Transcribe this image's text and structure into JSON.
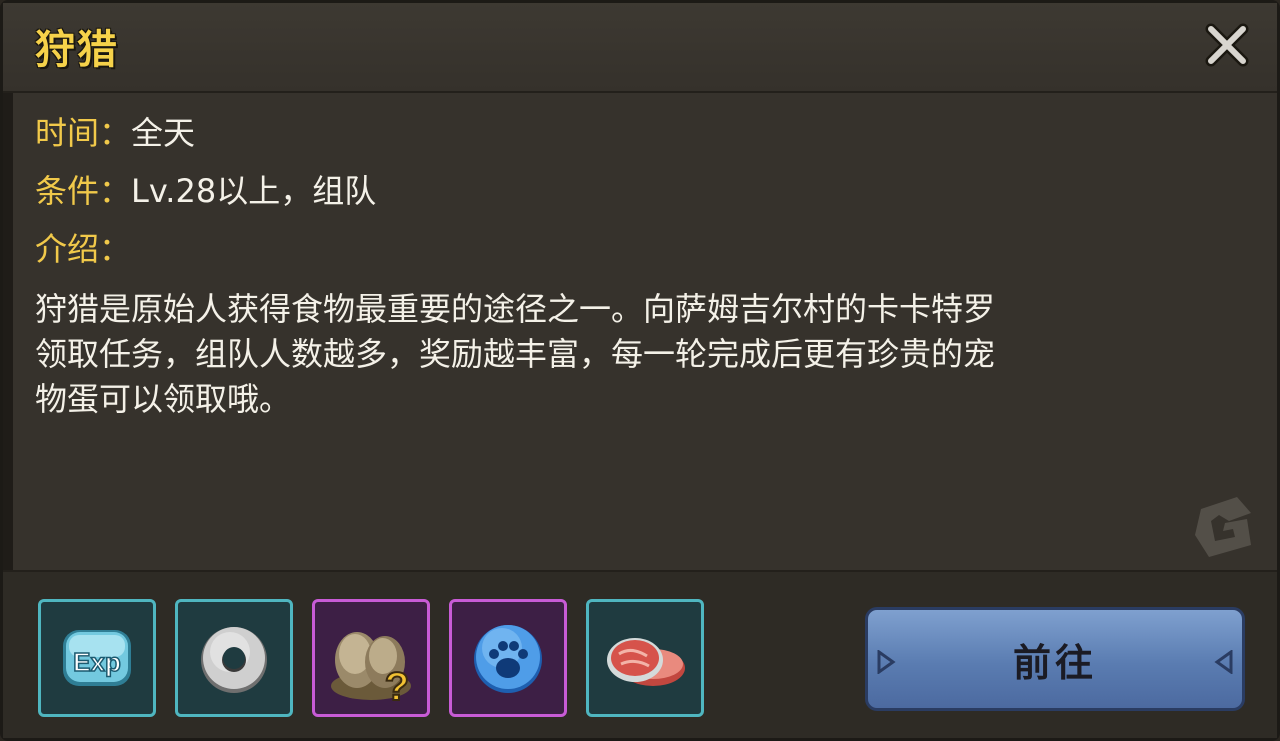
{
  "dialog": {
    "title": "狩猎",
    "close_icon": "close-icon"
  },
  "info": {
    "time_label": "时间：",
    "time_value": "全天",
    "condition_label": "条件：",
    "condition_value": "Lv.28以上，组队",
    "intro_label": "介绍：",
    "description_lines": [
      "狩猎是原始人获得食物最重要的途径之一。向萨姆吉尔村的卡卡特罗",
      "领取任务，组队人数越多，奖励越丰富，每一轮完成后更有珍贵的宠",
      "物蛋可以领取哦。"
    ]
  },
  "rewards": [
    {
      "icon": "exp-icon",
      "frame": "teal"
    },
    {
      "icon": "stone-ring-icon",
      "frame": "teal"
    },
    {
      "icon": "mystery-egg-icon",
      "frame": "purple"
    },
    {
      "icon": "paw-orb-icon",
      "frame": "purple"
    },
    {
      "icon": "meat-steak-icon",
      "frame": "teal"
    }
  ],
  "actions": {
    "go_label": "前往"
  },
  "colors": {
    "title": "#f6d24a",
    "label": "#f1c94a",
    "text": "#f4f1e8",
    "panel": "#36322c",
    "button": "#5a7cb1",
    "teal_frame": "#4fb6c0",
    "purple_frame": "#c85bd6"
  }
}
